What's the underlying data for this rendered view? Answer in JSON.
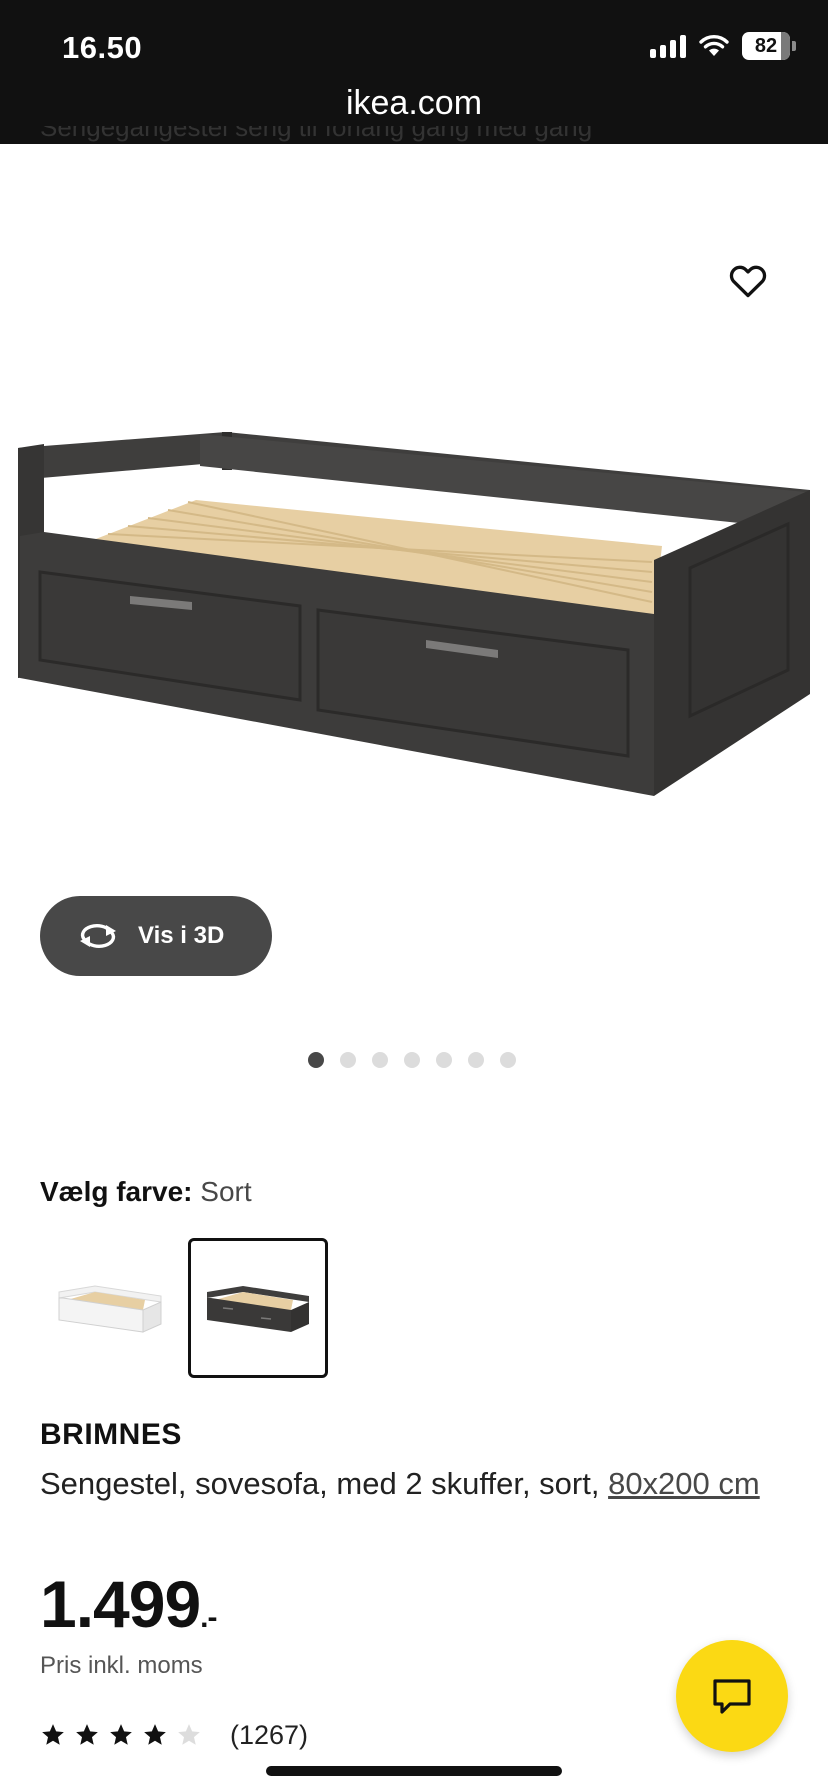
{
  "status_bar": {
    "time": "16.50",
    "battery": "82",
    "battery_level": 0.82,
    "url": "ikea.com"
  },
  "top_cut_text": "Sengegangestel seng til forlang gang med gang",
  "icons": {
    "favorite": "heart-icon",
    "rotate": "rotate-3d-icon",
    "chat": "chat-icon",
    "signal": "cellular-signal-icon",
    "wifi": "wifi-icon",
    "battery": "battery-icon"
  },
  "view_3d": {
    "label": "Vis i 3D"
  },
  "carousel": {
    "total": 7,
    "active_index": 0
  },
  "color_picker": {
    "label": "Vælg farve:",
    "selected": "Sort",
    "options": [
      {
        "name": "Hvid",
        "color": "#f2f2f2"
      },
      {
        "name": "Sort",
        "color": "#3a3a3a"
      }
    ]
  },
  "product": {
    "brand": "BRIMNES",
    "description": "Sengestel, sovesofa, med 2 skuffer, sort, ",
    "size": "80x200 cm",
    "price": "1.499",
    "price_suffix": ".-",
    "price_note": "Pris inkl. moms",
    "rating": 4,
    "rating_max": 5,
    "review_count": "(1267)"
  },
  "colors": {
    "status_bar_bg": "#111111",
    "button_dark": "#484848",
    "chat_yellow": "#fbd914",
    "wood": "#e7cfa3",
    "frame_black": "#3a3a3a"
  }
}
